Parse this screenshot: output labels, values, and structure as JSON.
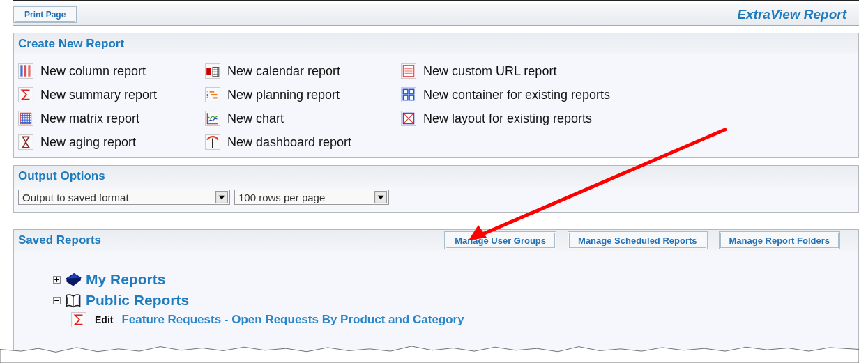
{
  "header": {
    "print_button": "Print Page",
    "title": "ExtraView Report"
  },
  "create_panel": {
    "title": "Create New Report",
    "columns": [
      [
        {
          "kind": "column",
          "label": "New column report"
        },
        {
          "kind": "summary",
          "label": "New summary report"
        },
        {
          "kind": "matrix",
          "label": "New matrix report"
        },
        {
          "kind": "aging",
          "label": "New aging report"
        }
      ],
      [
        {
          "kind": "calendar",
          "label": "New calendar report"
        },
        {
          "kind": "planning",
          "label": "New planning report"
        },
        {
          "kind": "chart",
          "label": "New chart"
        },
        {
          "kind": "dashboard",
          "label": "New dashboard report"
        }
      ],
      [
        {
          "kind": "url",
          "label": "New custom URL report"
        },
        {
          "kind": "container",
          "label": "New container for existing reports"
        },
        {
          "kind": "layout",
          "label": "New layout for existing reports"
        }
      ]
    ]
  },
  "output_panel": {
    "title": "Output Options",
    "format_select": "Output to saved format",
    "rows_select": "100 rows per page"
  },
  "saved_panel": {
    "title": "Saved Reports",
    "buttons": [
      "Manage User Groups",
      "Manage Scheduled Reports",
      "Manage Report Folders"
    ],
    "tree": [
      {
        "label": "My Reports",
        "expanded": false
      },
      {
        "label": "Public Reports",
        "expanded": true,
        "children": [
          {
            "kind": "summary",
            "action": "Edit",
            "label": "Feature Requests - Open Requests By Product and Category"
          }
        ]
      }
    ]
  }
}
